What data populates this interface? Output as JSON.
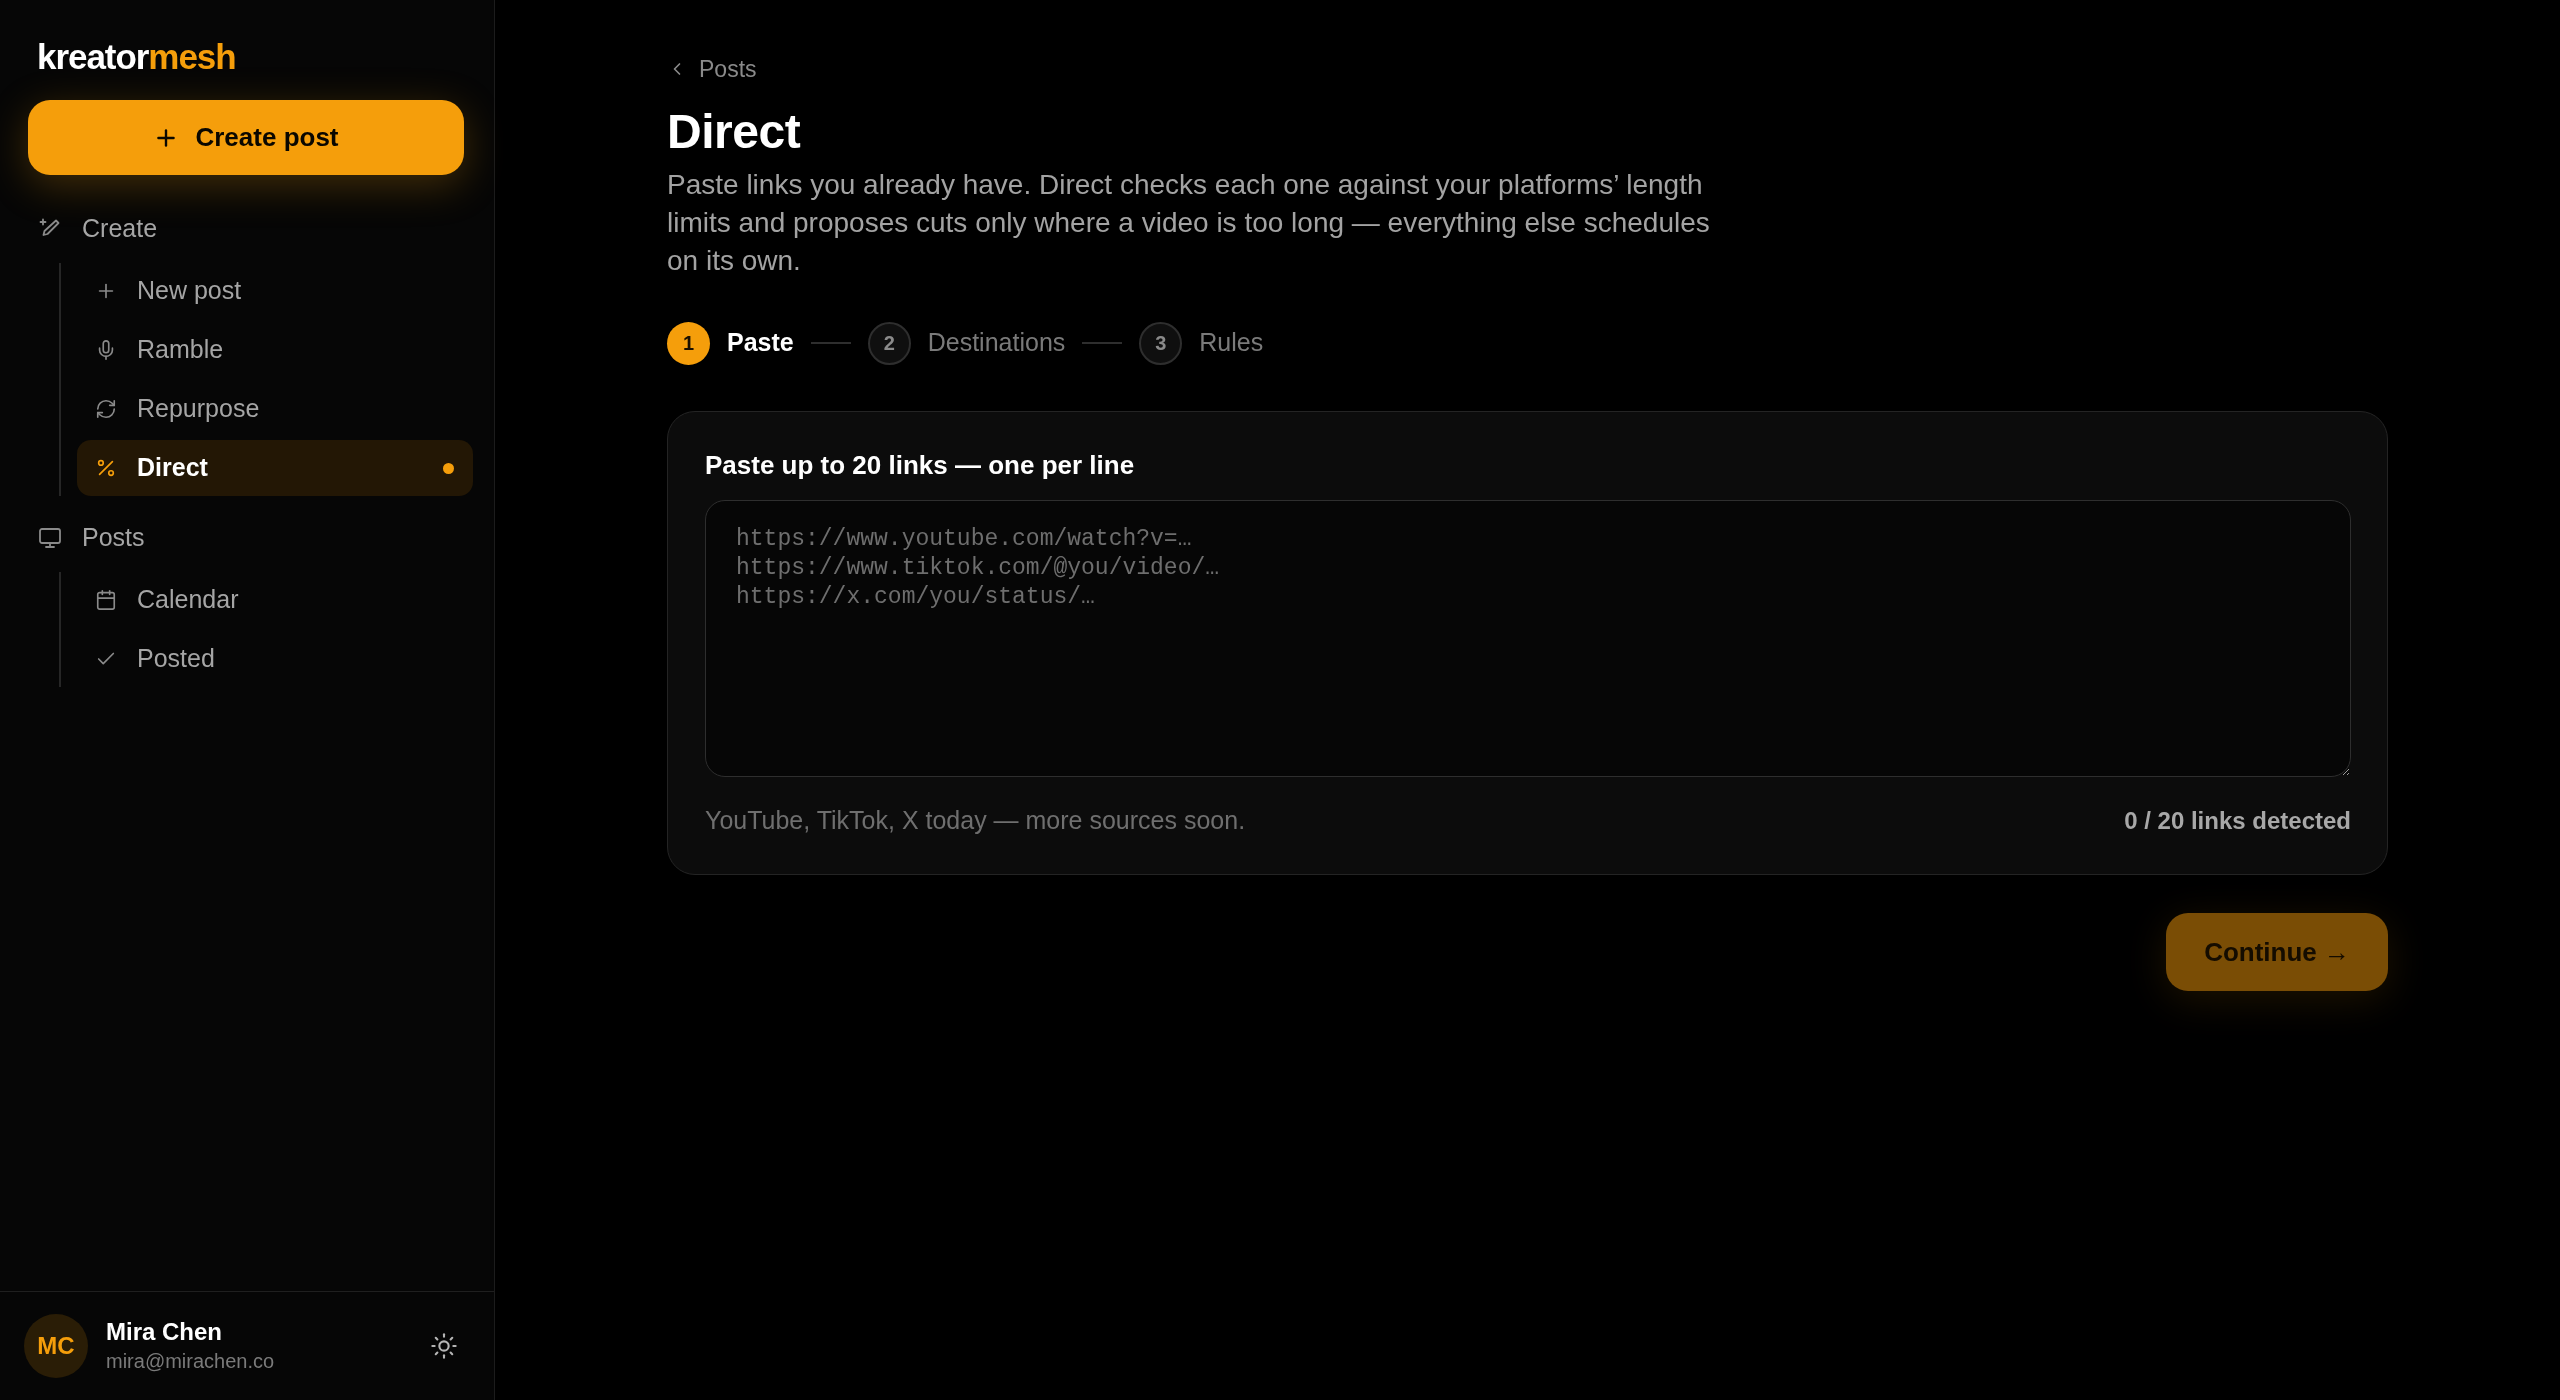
{
  "sidebar": {
    "logo": {
      "primary": "kreator",
      "accent": "mesh"
    },
    "create_button": {
      "label": "Create post"
    },
    "nav": [
      {
        "label": "Create",
        "children": [
          {
            "label": "New post",
            "selected": false
          },
          {
            "label": "Ramble",
            "selected": false
          },
          {
            "label": "Repurpose",
            "selected": false
          },
          {
            "label": "Direct",
            "selected": true
          }
        ]
      },
      {
        "label": "Posts",
        "children": [
          {
            "label": "Calendar",
            "selected": false
          },
          {
            "label": "Posted",
            "selected": false
          }
        ]
      }
    ],
    "user": {
      "initials": "MC",
      "name": "Mira Chen",
      "email": "mira@mirachen.co"
    }
  },
  "main": {
    "breadcrumb": "Posts",
    "title": "Direct",
    "description": "Paste links you already have. Direct checks each one against your platforms’ length limits and proposes cuts only where a video is too long — everything else schedules on its own.",
    "steps": [
      {
        "number": "1",
        "label": "Paste",
        "selected": true
      },
      {
        "number": "2",
        "label": "Destinations",
        "selected": false
      },
      {
        "number": "3",
        "label": "Rules",
        "selected": false
      }
    ],
    "links_card": {
      "label": "Paste up to 20 links — one per line",
      "links_field": {
        "placeholder": "https://www.youtube.com/watch?v=…\nhttps://www.tiktok.com/@you/video/…\nhttps://x.com/you/status/…"
      },
      "hint": "YouTube, TikTok, X today — more sources soon.",
      "count": "0 / 20 links detected"
    },
    "continue_button": {
      "label": "Continue →",
      "disabled": true
    }
  }
}
